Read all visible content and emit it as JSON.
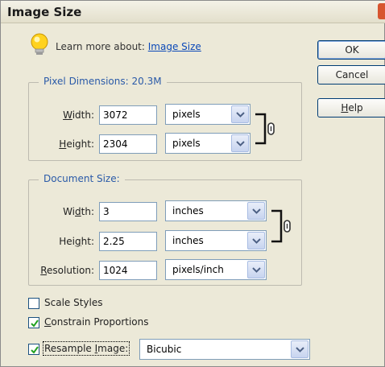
{
  "window": {
    "title": "Image Size"
  },
  "help": {
    "prefix": "Learn more about:",
    "link": "Image Size"
  },
  "buttons": {
    "ok": "OK",
    "cancel": "Cancel",
    "help": "Help"
  },
  "pixel_dimensions": {
    "legend": "Pixel Dimensions:",
    "size": "20.3M",
    "width": {
      "label": "Width:",
      "value": "3072",
      "unit": "pixels"
    },
    "height": {
      "label": "Height:",
      "value": "2304",
      "unit": "pixels"
    }
  },
  "document_size": {
    "legend": "Document Size:",
    "width": {
      "label": "Width:",
      "value": "3",
      "unit": "inches"
    },
    "height": {
      "label": "Height:",
      "value": "2.25",
      "unit": "inches"
    },
    "resolution": {
      "label": "Resolution:",
      "value": "1024",
      "unit": "pixels/inch"
    }
  },
  "options": {
    "scale_styles": {
      "label": "Scale Styles",
      "checked": false
    },
    "constrain": {
      "label": "Constrain Proportions",
      "checked": true
    },
    "resample": {
      "label": "Resample Image:",
      "checked": true,
      "method": "Bicubic"
    }
  }
}
